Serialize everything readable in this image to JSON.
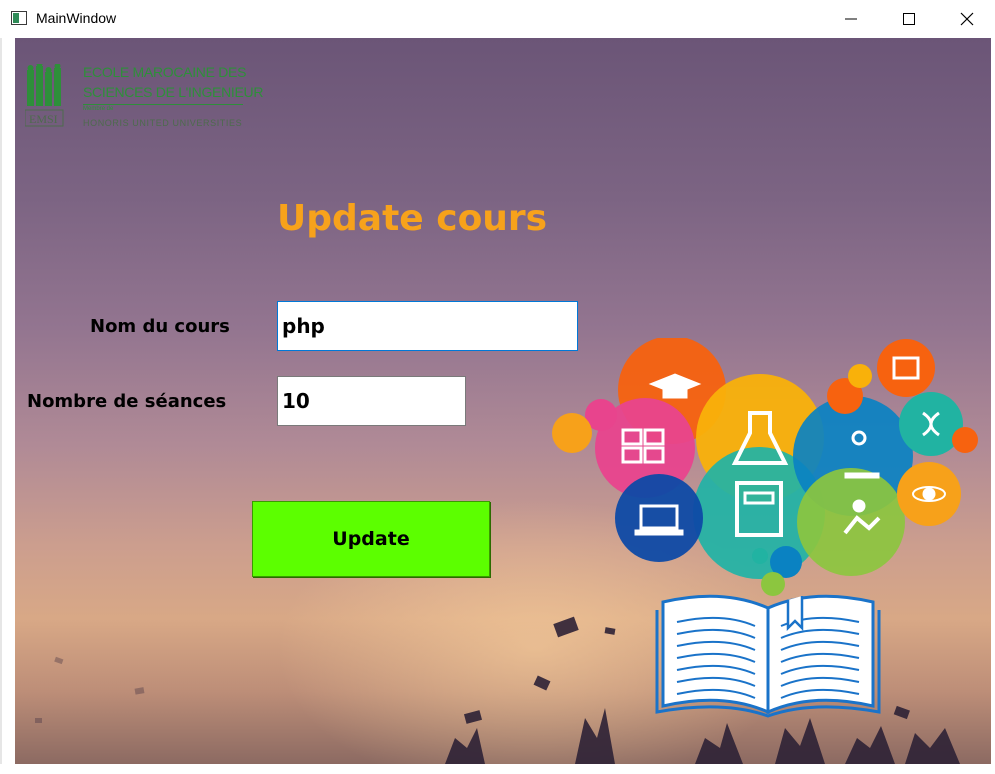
{
  "window": {
    "title": "MainWindow"
  },
  "logo": {
    "line1": "ECOLE MAROCAINE DES",
    "line2": "SCIENCES DE L'INGENIEUR",
    "subline": "Membre de",
    "tagline": "HONORIS UNITED UNIVERSITIES",
    "mark_text": "EMSI",
    "color": "#2e8f3a"
  },
  "form": {
    "heading": "Update cours",
    "heading_color": "#f7a21b",
    "course_name_label": "Nom du cours",
    "course_name_value": "php",
    "sessions_label": "Nombre de séances",
    "sessions_value": "10",
    "update_label": "Update",
    "update_color": "#5cff00"
  }
}
